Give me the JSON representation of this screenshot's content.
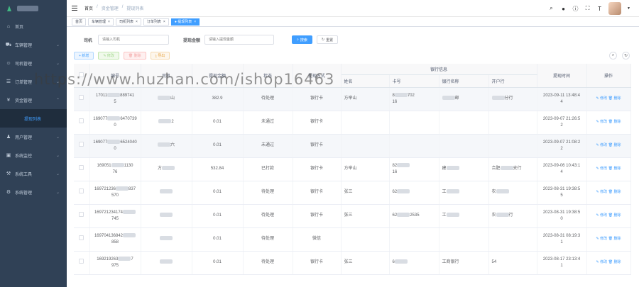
{
  "sidebar": {
    "items": [
      {
        "label": "首页",
        "icon": "dashboard-icon",
        "arrow": ""
      },
      {
        "label": "车辆管理",
        "icon": "car-icon",
        "arrow": "⌄"
      },
      {
        "label": "司机管理",
        "icon": "driver-icon",
        "arrow": "⌄"
      },
      {
        "label": "订单管理",
        "icon": "order-icon",
        "arrow": "⌄"
      },
      {
        "label": "资金管理",
        "icon": "money-icon",
        "arrow": "⌃"
      },
      {
        "label": "提现列表",
        "icon": "",
        "arrow": "",
        "sub": true
      },
      {
        "label": "用户管理",
        "icon": "user-icon",
        "arrow": "⌄"
      },
      {
        "label": "系统监控",
        "icon": "monitor-icon",
        "arrow": "⌄"
      },
      {
        "label": "系统工具",
        "icon": "tool-icon",
        "arrow": "⌄"
      },
      {
        "label": "系统管理",
        "icon": "gear-icon",
        "arrow": "⌄"
      }
    ]
  },
  "breadcrumb": {
    "home": "首页",
    "level1": "资金管理",
    "level2": "提现列表",
    "sep": "/"
  },
  "tags": [
    {
      "label": "首页",
      "close": ""
    },
    {
      "label": "车辆管理",
      "close": "×"
    },
    {
      "label": "司机列表",
      "close": "×"
    },
    {
      "label": "订单列表",
      "close": "×"
    },
    {
      "label": "● 提现列表",
      "close": "×",
      "active": true
    }
  ],
  "search": {
    "driver_label": "司机",
    "driver_placeholder": "请输入司机",
    "amount_label": "提现金额",
    "amount_placeholder": "请输入提现金额",
    "search_btn": "搜索",
    "reset_btn": "重置"
  },
  "toolbar": {
    "add": "+ 新增",
    "edit": "✎ 修改",
    "delete": "🗑 删除",
    "export": "⤓ 导出"
  },
  "table": {
    "headers": {
      "serial": "编号",
      "driver": "司机",
      "amount": "提现金额",
      "status": "状态",
      "method": "提现方式",
      "bank_group": "银行信息",
      "name": "姓名",
      "card": "卡号",
      "bank": "银行名称",
      "branch": "开户行",
      "time": "提现时间",
      "ops": "操作"
    },
    "rows": [
      {
        "serial": "17011[]889741\n5",
        "driver": "[]山",
        "amount": "382.9",
        "status": "待处理",
        "method": "银行卡",
        "name": "方举山",
        "card": "8[]702\n16",
        "bank": "[]邮",
        "branch": "[]分行",
        "time": "2023-09-11 13:48:4\n4"
      },
      {
        "serial": "169077[]6470739\n0",
        "driver": "[]2",
        "amount": "0.01",
        "status": "未通过",
        "method": "银行卡",
        "name": "",
        "card": "",
        "bank": "",
        "branch": "",
        "time": "2023-09-07 21:26:5\n2"
      },
      {
        "serial": "169077[]6524040\n0",
        "driver": "[]六",
        "amount": "0.01",
        "status": "未通过",
        "method": "银行卡",
        "name": "",
        "card": "",
        "bank": "",
        "branch": "",
        "time": "2023-09-07 21:08:2\n2"
      },
      {
        "serial": "169051[]1130\n76",
        "driver": "方[]",
        "amount": "532.84",
        "status": "已打款",
        "method": "银行卡",
        "name": "方举山",
        "card": "82[]\n16",
        "bank": "建[]",
        "branch": "合肥[]支行",
        "time": "2023-09-06 10:43:1\n4"
      },
      {
        "serial": "169721236[]837\n570",
        "driver": "[]",
        "amount": "0.01",
        "status": "待处理",
        "method": "银行卡",
        "name": "张三",
        "card": "62[]",
        "bank": "工[]",
        "branch": "农[]",
        "time": "2023-08-31 19:38:5\n5"
      },
      {
        "serial": "169721234174[]\n745",
        "driver": "[]",
        "amount": "0.01",
        "status": "待处理",
        "method": "银行卡",
        "name": "张三",
        "card": "62[]2535",
        "bank": "工[]",
        "branch": "农[]行",
        "time": "2023-08-31 19:38:5\n0"
      },
      {
        "serial": "169704136842[]\n858",
        "driver": "[]",
        "amount": "0.01",
        "status": "待处理",
        "method": "微信",
        "name": "",
        "card": "",
        "bank": "",
        "branch": "",
        "time": "2023-08-31 08:19:3\n1"
      },
      {
        "serial": "169219263[]7\n975",
        "driver": "[]",
        "amount": "0.01",
        "status": "待处理",
        "method": "银行卡",
        "name": "张三",
        "card": "6[]",
        "bank": "工商银行",
        "branch": "54",
        "time": "2023-08-17 23:13:4\n1"
      }
    ],
    "op_edit": "✎ 修改",
    "op_delete": "🗑 删除"
  },
  "watermark": "https://www.huzhan.com/ishop16463"
}
